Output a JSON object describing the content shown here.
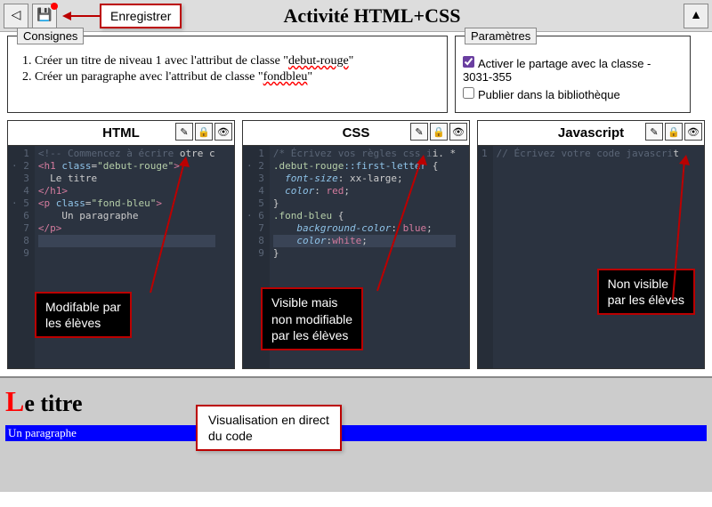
{
  "topbar": {
    "title": "Activité HTML+CSS",
    "save_callout": "Enregistrer"
  },
  "consignes": {
    "label": "Consignes",
    "item1_prefix": "Créer un titre de niveau 1 avec l'attribut de classe \"",
    "item1_class": "debut-rouge",
    "item1_suffix": "\"",
    "item2_prefix": "Créer un paragraphe avec l'attribut de classe \"",
    "item2_class": "fondbleu",
    "item2_suffix": "\""
  },
  "params": {
    "label": "Paramètres",
    "share": "Activer le partage avec la classe - 3031-355",
    "publish": "Publier dans la bibliothèque"
  },
  "editors": {
    "html": {
      "title": "HTML",
      "lines": [
        "<!-- Commencez à écrire votre c",
        "<h1 class=\"debut-rouge\">",
        "  Le titre",
        "</h1>",
        "<p class=\"fond-bleu\">",
        "    Un paragraphe",
        "</p>",
        "",
        ""
      ]
    },
    "css": {
      "title": "CSS",
      "lines": [
        "/* Écrivez vos règles css ici. *",
        ".debut-rouge::first-letter {",
        "  font-size: xx-large;",
        "  color: red;",
        "}",
        ".fond-bleu {",
        "    background-color: blue;",
        "    color:white;",
        "}"
      ]
    },
    "js": {
      "title": "Javascript",
      "lines": [
        "// Écrivez votre code javascript"
      ]
    }
  },
  "callouts": {
    "html": "Modifable par\nles élèves",
    "css": "Visible mais\nnon modifiable\npar les élèves",
    "js": "Non visible\npar les élèves",
    "preview": "Visualisation en direct\ndu code"
  },
  "preview": {
    "heading": "Le titre",
    "paragraph": "Un paragraphe"
  }
}
